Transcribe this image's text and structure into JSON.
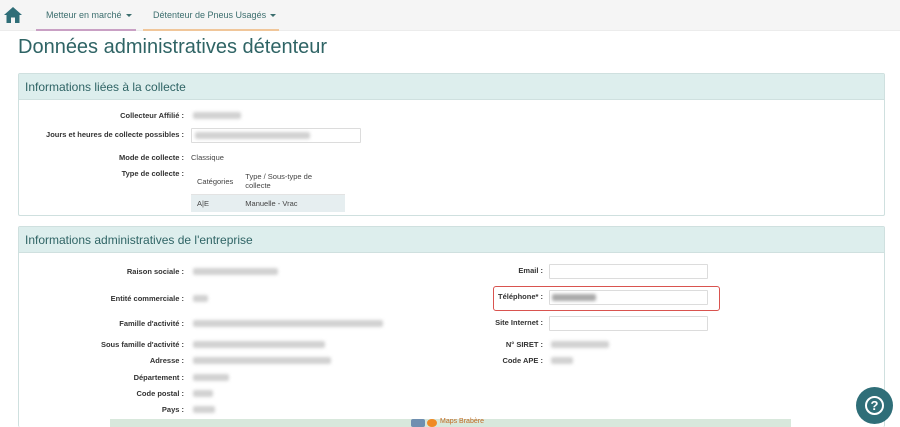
{
  "nav": {
    "home_icon": "home-icon",
    "tabs": [
      {
        "label": "Metteur en marché"
      },
      {
        "label": "Détenteur de Pneus Usagés"
      }
    ]
  },
  "page": {
    "title": "Données administratives détenteur"
  },
  "collecte": {
    "title": "Informations liées à la collecte",
    "collecteur_label": "Collecteur Affilié :",
    "jours_label": "Jours et heures de collecte possibles :",
    "mode_label": "Mode de collecte :",
    "mode_value": "Classique",
    "type_label": "Type de collecte :",
    "table": {
      "headers": [
        "Catégories",
        "Type / Sous-type de collecte"
      ],
      "rows": [
        [
          "A|E",
          "Manuelle - Vrac"
        ]
      ]
    }
  },
  "entreprise": {
    "title": "Informations administratives de l'entreprise",
    "raison_label": "Raison sociale :",
    "entite_label": "Entité commerciale :",
    "famille_label": "Famille d'activité :",
    "sous_famille_label": "Sous famille d'activité :",
    "adresse_label": "Adresse :",
    "departement_label": "Département :",
    "code_postal_label": "Code postal :",
    "pays_label": "Pays :",
    "email_label": "Email :",
    "telephone_label": "Téléphone* :",
    "site_label": "Site Internet :",
    "siret_label": "N° SIRET :",
    "code_ape_label": "Code APE :"
  },
  "map": {
    "label": "Maps Brabère"
  },
  "help": {
    "icon": "help-icon",
    "glyph": "?"
  },
  "colors": {
    "accent": "#2f6465",
    "panel_header": "#ddeeed",
    "highlight": "#d9534f",
    "help_button": "#2f6e78"
  }
}
